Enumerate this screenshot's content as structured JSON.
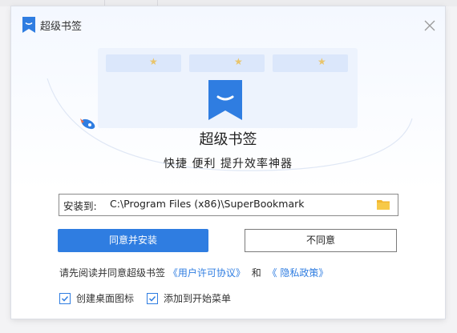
{
  "app": {
    "title": "超级书签"
  },
  "brand": {
    "name": "超级书签",
    "slogan": "快捷 便利 提升效率神器",
    "accent": "#2f7de1"
  },
  "install": {
    "path_label": "安装到:",
    "path_value": "C:\\Program Files (x86)\\SuperBookmark"
  },
  "buttons": {
    "agree": "同意并安装",
    "disagree": "不同意"
  },
  "terms": {
    "prefix": "请先阅读并同意超级书签",
    "license": "《用户许可协议》",
    "and": "和",
    "privacy": "《 隐私政策》"
  },
  "options": {
    "desktop_icon": {
      "label": "创建桌面图标",
      "checked": true
    },
    "start_menu": {
      "label": "添加到开始菜单",
      "checked": true
    }
  },
  "icons": {
    "close": "close-icon",
    "folder": "folder-icon",
    "logo": "bookmark-logo-icon",
    "rocket": "rocket-icon",
    "star": "star-icon",
    "check": "check-icon"
  }
}
